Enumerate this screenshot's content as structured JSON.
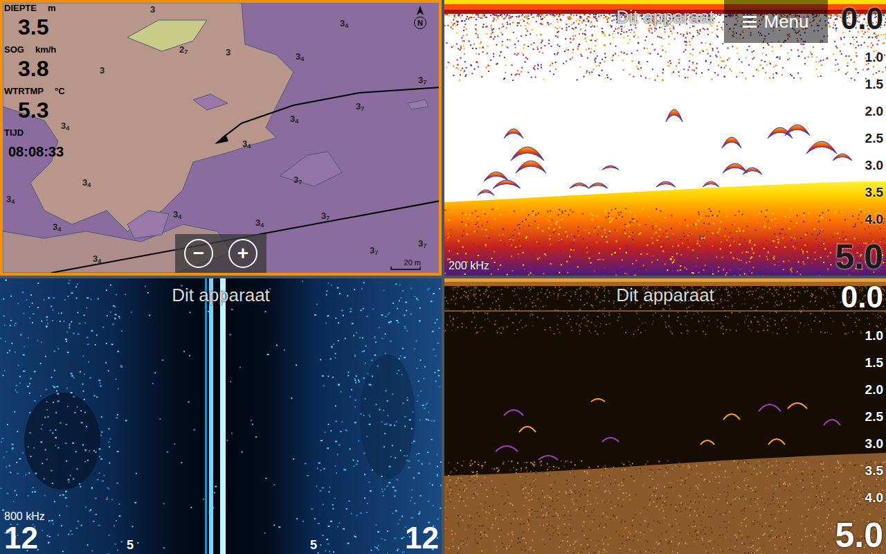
{
  "map": {
    "active": true,
    "data_fields": [
      {
        "label": "DIEPTE",
        "unit": "m",
        "value": "3.5",
        "kind": "number"
      },
      {
        "label": "SOG",
        "unit": "km/h",
        "value": "3.8",
        "kind": "number"
      },
      {
        "label": "WTRTMP",
        "unit": "°C",
        "value": "5.3",
        "kind": "number"
      },
      {
        "label": "TIJD",
        "unit": "",
        "value": "08:08:33",
        "kind": "time"
      }
    ],
    "soundings": [
      {
        "value": "3",
        "decimal": ""
      },
      {
        "value": "3",
        "decimal": "4"
      },
      {
        "value": "2",
        "decimal": "7"
      },
      {
        "value": "3",
        "decimal": ""
      },
      {
        "value": "3",
        "decimal": "4"
      },
      {
        "value": "3",
        "decimal": ""
      },
      {
        "value": "3",
        "decimal": "7"
      },
      {
        "value": "3",
        "decimal": "7"
      },
      {
        "value": "3",
        "decimal": "4"
      },
      {
        "value": "3",
        "decimal": "4"
      },
      {
        "value": "3",
        "decimal": "4"
      },
      {
        "value": "3",
        "decimal": "4"
      },
      {
        "value": "3",
        "decimal": "7"
      },
      {
        "value": "3",
        "decimal": "4"
      },
      {
        "value": "3",
        "decimal": "4"
      },
      {
        "value": "3",
        "decimal": "4"
      },
      {
        "value": "3",
        "decimal": "4"
      },
      {
        "value": "3",
        "decimal": "7"
      },
      {
        "value": "3",
        "decimal": "7"
      },
      {
        "value": "3",
        "decimal": "4"
      },
      {
        "value": "3",
        "decimal": "7"
      }
    ],
    "zoom_buttons": [
      "−",
      "+"
    ],
    "scale": "20 m",
    "north": "N"
  },
  "sonar": {
    "source": "Dit apparaat",
    "menu": "Menu",
    "range_top": "0.0",
    "depth_ticks": [
      "1.0",
      "1.5",
      "2.0",
      "2.5",
      "3.0",
      "3.5",
      "4.0"
    ],
    "range_bottom": "5.0",
    "frequency": "200 kHz"
  },
  "sidescan": {
    "source": "Dit apparaat",
    "frequency": "800 kHz",
    "range_left": "12",
    "range_right": "12",
    "ticks": [
      "5",
      "5"
    ]
  },
  "downscan": {
    "source": "Dit apparaat",
    "range_top": "0.0",
    "depth_ticks": [
      "1.0",
      "1.5",
      "2.0",
      "2.5",
      "3.0",
      "3.5",
      "4.0"
    ],
    "range_bottom": "5.0"
  }
}
